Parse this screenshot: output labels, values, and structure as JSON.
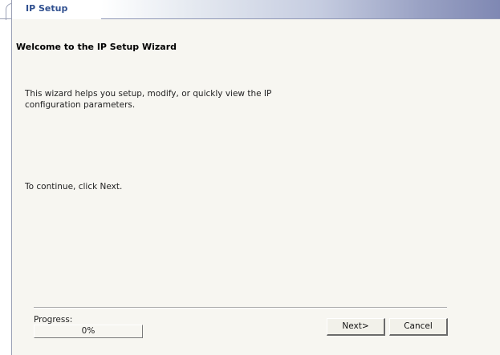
{
  "tab": {
    "label": "IP Setup"
  },
  "wizard": {
    "title": "Welcome to the IP Setup Wizard",
    "description": "This wizard helps you setup, modify, or quickly view the IP configuration parameters.",
    "continue_text": "To continue, click Next."
  },
  "progress": {
    "label": "Progress:",
    "value_text": "0%",
    "fraction": 0
  },
  "buttons": {
    "next_label": "Next>",
    "cancel_label": "Cancel"
  },
  "colors": {
    "panel_bg": "#f7f6f1",
    "tab_text": "#2f4f8f"
  }
}
